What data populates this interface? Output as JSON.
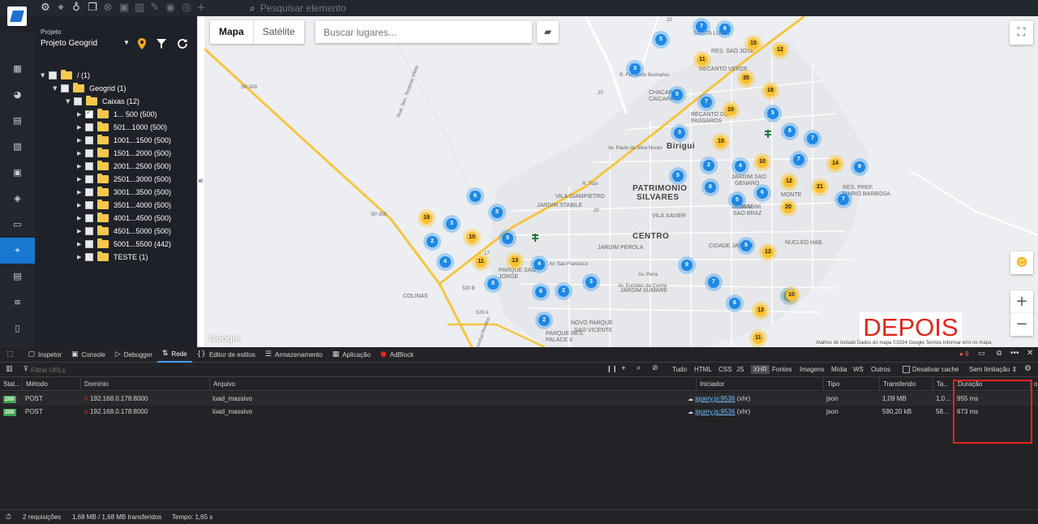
{
  "topbar": {
    "search_placeholder": "Pesquisar elemento",
    "icons": [
      "gear-icon",
      "map-pin-icon",
      "lightbulb-icon",
      "copy-icon",
      "close-circle-icon",
      "folder-add-icon",
      "trash-icon",
      "pencil-icon",
      "eye-icon",
      "target-icon",
      "plus-icon"
    ]
  },
  "rail": {
    "items": [
      "dashboard-icon",
      "chart-pie-icon",
      "contact-icon",
      "layout-icon",
      "calendar-icon",
      "package-icon",
      "money-icon",
      "location-icon",
      "document-icon",
      "server-icon",
      "file-icon"
    ],
    "active": "location-icon"
  },
  "panel": {
    "project_label": "Projeto",
    "project_value": "Projeto Geogrid",
    "tree": [
      {
        "label": "/ (1)",
        "level": 0,
        "arrow": "▼"
      },
      {
        "label": "Geogrid (1)",
        "level": 1,
        "arrow": "▼"
      },
      {
        "label": "Caixas (12)",
        "level": 2,
        "arrow": "▼"
      },
      {
        "label": "1... 500 (500)",
        "level": 3,
        "arrow": "▶",
        "checked": true
      },
      {
        "label": "501...1000 (500)",
        "level": 3,
        "arrow": "▶"
      },
      {
        "label": "1001...1500 (500)",
        "level": 3,
        "arrow": "▶"
      },
      {
        "label": "1501...2000 (500)",
        "level": 3,
        "arrow": "▶"
      },
      {
        "label": "2001...2500 (500)",
        "level": 3,
        "arrow": "▶"
      },
      {
        "label": "2501...3000 (500)",
        "level": 3,
        "arrow": "▶"
      },
      {
        "label": "3001...3500 (500)",
        "level": 3,
        "arrow": "▶"
      },
      {
        "label": "3501...4000 (500)",
        "level": 3,
        "arrow": "▶"
      },
      {
        "label": "4001...4500 (500)",
        "level": 3,
        "arrow": "▶"
      },
      {
        "label": "4501...5000 (500)",
        "level": 3,
        "arrow": "▶"
      },
      {
        "label": "5001...5500 (442)",
        "level": 3,
        "arrow": "▶"
      },
      {
        "label": "TESTE (1)",
        "level": 3,
        "arrow": "▶"
      }
    ],
    "collapse_glyph": "«"
  },
  "map": {
    "tabs": [
      "Mapa",
      "Satélite"
    ],
    "active_tab": "Mapa",
    "search_placeholder": "Buscar lugares...",
    "overlay_label": "DEPOIS",
    "google_label": "Google",
    "attribution": "Atalhos do teclado   Dados do mapa ©2024 Google   Termos   Informar erro no mapa",
    "zoom_in": "+",
    "zoom_out": "−",
    "places": [
      {
        "text": "Birigui",
        "cls": "big"
      },
      {
        "text": "PATRIMONIO",
        "cls": "big"
      },
      {
        "text": "SILVARES",
        "cls": "big"
      },
      {
        "text": "CENTRO",
        "cls": "big"
      },
      {
        "text": "JARDIM STABILE",
        "cls": ""
      },
      {
        "text": "JARDIM PEROLA",
        "cls": ""
      },
      {
        "text": "VILA XAVIER",
        "cls": ""
      },
      {
        "text": "VILA GIAMPIETRO",
        "cls": ""
      },
      {
        "text": "COLINAS",
        "cls": ""
      },
      {
        "text": "JARDIM SUMARE",
        "cls": ""
      },
      {
        "text": "CIDADE JARDIM",
        "cls": ""
      },
      {
        "text": "NOVO PARQUE",
        "cls": ""
      },
      {
        "text": "SAO VICENTE",
        "cls": ""
      },
      {
        "text": "PARQUE SAO",
        "cls": ""
      },
      {
        "text": "JORGE",
        "cls": ""
      },
      {
        "text": "PARQUE RES.",
        "cls": ""
      },
      {
        "text": "PALACE II",
        "cls": ""
      },
      {
        "text": "JARDIM SAO",
        "cls": ""
      },
      {
        "text": "GENARO",
        "cls": ""
      },
      {
        "text": "JARDIM",
        "cls": ""
      },
      {
        "text": "SAO BRAZ",
        "cls": ""
      },
      {
        "text": "RES. PREF.",
        "cls": ""
      },
      {
        "text": "MARIO BARBOSA",
        "cls": ""
      },
      {
        "text": "JARDIM",
        "cls": ""
      },
      {
        "text": "RECANTO DOS",
        "cls": ""
      },
      {
        "text": "PASSAROS",
        "cls": ""
      },
      {
        "text": "RES. SAO JOSE",
        "cls": ""
      },
      {
        "text": "RECANTO VERDE",
        "cls": ""
      },
      {
        "text": "CHACARA",
        "cls": ""
      },
      {
        "text": "CAICAPA",
        "cls": ""
      },
      {
        "text": "SANTA LUZIA",
        "cls": ""
      },
      {
        "text": "NUCLEO HAB.",
        "cls": ""
      },
      {
        "text": "MONTE",
        "cls": ""
      },
      {
        "text": "Av. Sao Francisco",
        "cls": "road"
      },
      {
        "text": "Av. Euclides da Cunha",
        "cls": "road"
      },
      {
        "text": "Av. Pena",
        "cls": "road"
      },
      {
        "text": "R. Tupi",
        "cls": "road"
      },
      {
        "text": "Rod. Marechal Rondon",
        "cls": "road"
      },
      {
        "text": "R. Fernando Bucharles",
        "cls": "road"
      },
      {
        "text": "Av. Paulo da Silva Nunes",
        "cls": "road"
      },
      {
        "text": "Rod. Sen. Teotonio Vilela",
        "cls": "road"
      },
      {
        "text": "SP-300",
        "cls": "road"
      },
      {
        "text": "SP-300",
        "cls": "road"
      },
      {
        "text": "520 B",
        "cls": "road"
      },
      {
        "text": "520 A",
        "cls": "road"
      },
      {
        "text": "22",
        "cls": "road"
      },
      {
        "text": "20",
        "cls": "road"
      },
      {
        "text": "20",
        "cls": "road"
      },
      {
        "text": "17",
        "cls": "road"
      }
    ],
    "clusters": [
      {
        "n": "7",
        "c": "blue"
      },
      {
        "n": "6",
        "c": "blue"
      },
      {
        "n": "5",
        "c": "blue"
      },
      {
        "n": "15",
        "c": "yellow"
      },
      {
        "n": "12",
        "c": "yellow"
      },
      {
        "n": "11",
        "c": "yellow"
      },
      {
        "n": "3",
        "c": "blue"
      },
      {
        "n": "35",
        "c": "yellow"
      },
      {
        "n": "18",
        "c": "yellow"
      },
      {
        "n": "5",
        "c": "blue"
      },
      {
        "n": "7",
        "c": "blue"
      },
      {
        "n": "10",
        "c": "yellow"
      },
      {
        "n": "5",
        "c": "blue"
      },
      {
        "n": "3",
        "c": "blue"
      },
      {
        "n": "6",
        "c": "blue"
      },
      {
        "n": "7",
        "c": "blue"
      },
      {
        "n": "15",
        "c": "yellow"
      },
      {
        "n": "2",
        "c": "blue"
      },
      {
        "n": "10",
        "c": "yellow"
      },
      {
        "n": "7",
        "c": "blue"
      },
      {
        "n": "4",
        "c": "blue"
      },
      {
        "n": "14",
        "c": "yellow"
      },
      {
        "n": "9",
        "c": "blue"
      },
      {
        "n": "5",
        "c": "blue"
      },
      {
        "n": "12",
        "c": "yellow"
      },
      {
        "n": "21",
        "c": "yellow"
      },
      {
        "n": "6",
        "c": "blue"
      },
      {
        "n": "6",
        "c": "blue"
      },
      {
        "n": "7",
        "c": "blue"
      },
      {
        "n": "5",
        "c": "blue"
      },
      {
        "n": "20",
        "c": "yellow"
      },
      {
        "n": "6",
        "c": "blue"
      },
      {
        "n": "5",
        "c": "blue"
      },
      {
        "n": "19",
        "c": "yellow"
      },
      {
        "n": "3",
        "c": "blue"
      },
      {
        "n": "10",
        "c": "yellow"
      },
      {
        "n": "2",
        "c": "blue"
      },
      {
        "n": "5",
        "c": "blue"
      },
      {
        "n": "9",
        "c": "blue"
      },
      {
        "n": "12",
        "c": "yellow"
      },
      {
        "n": "4",
        "c": "blue"
      },
      {
        "n": "11",
        "c": "yellow"
      },
      {
        "n": "13",
        "c": "yellow"
      },
      {
        "n": "4",
        "c": "blue"
      },
      {
        "n": "8",
        "c": "blue"
      },
      {
        "n": "9",
        "c": "blue"
      },
      {
        "n": "2",
        "c": "blue"
      },
      {
        "n": "7",
        "c": "blue"
      },
      {
        "n": "6",
        "c": "blue"
      },
      {
        "n": "3",
        "c": "blue"
      },
      {
        "n": "7",
        "c": "blue"
      },
      {
        "n": "6",
        "c": "blue"
      },
      {
        "n": "10",
        "c": "yellow"
      },
      {
        "n": "13",
        "c": "yellow"
      },
      {
        "n": "2",
        "c": "blue"
      },
      {
        "n": "11",
        "c": "yellow"
      }
    ]
  },
  "devtools": {
    "tabs": [
      {
        "label": "Inspetor",
        "icon": "inspector-icon",
        "glyph": "▢"
      },
      {
        "label": "Console",
        "icon": "console-icon",
        "glyph": "▣"
      },
      {
        "label": "Debugger",
        "icon": "debugger-icon",
        "glyph": "▷"
      },
      {
        "label": "Rede",
        "icon": "network-icon",
        "glyph": "⇅"
      },
      {
        "label": "Editor de estilos",
        "icon": "style-editor-icon",
        "glyph": "{}"
      },
      {
        "label": "Armazenamento",
        "icon": "storage-icon",
        "glyph": "☰"
      },
      {
        "label": "Aplicação",
        "icon": "application-icon",
        "glyph": "▦"
      },
      {
        "label": "AdBlock",
        "icon": "adblock-icon",
        "glyph": "●"
      }
    ],
    "active_tab": "Rede",
    "error_count": "9",
    "filter_placeholder": "Filtrar URLs",
    "filter_types": [
      "Tudo",
      "HTML",
      "CSS",
      "JS",
      "XHR",
      "Fontes",
      "Imagens",
      "Mídia",
      "WS",
      "Outros"
    ],
    "active_filter": "XHR",
    "disable_cache": "Desativar cache",
    "throttle": "Sem limitação ⇕",
    "columns": [
      "Stat...",
      "Método",
      "Domínio",
      "Arquivo",
      "Iniciador",
      "Tipo",
      "Transferido",
      "Ta...",
      "Duração",
      "o"
    ],
    "rows": [
      {
        "status": "200",
        "method": "POST",
        "domain": "192.168.0.178:8000",
        "file": "load_massivo",
        "initiator": "jquery.js:9536",
        "initiator_suffix": "(xhr)",
        "type": "json",
        "transferred": "1,09 MB",
        "size": "1,0...",
        "duration": "955 ms"
      },
      {
        "status": "200",
        "method": "POST",
        "domain": "192.168.0.178:8000",
        "file": "load_massivo",
        "initiator": "jquery.js:9536",
        "initiator_suffix": "(xhr)",
        "type": "json",
        "transferred": "590,20 kB",
        "size": "58...",
        "duration": "673 ms"
      }
    ],
    "footer": {
      "requests": "2 requisições",
      "transfer": "1,68 MB / 1,68 MB transferidos",
      "time": "Tempo: 1,65 s"
    }
  }
}
